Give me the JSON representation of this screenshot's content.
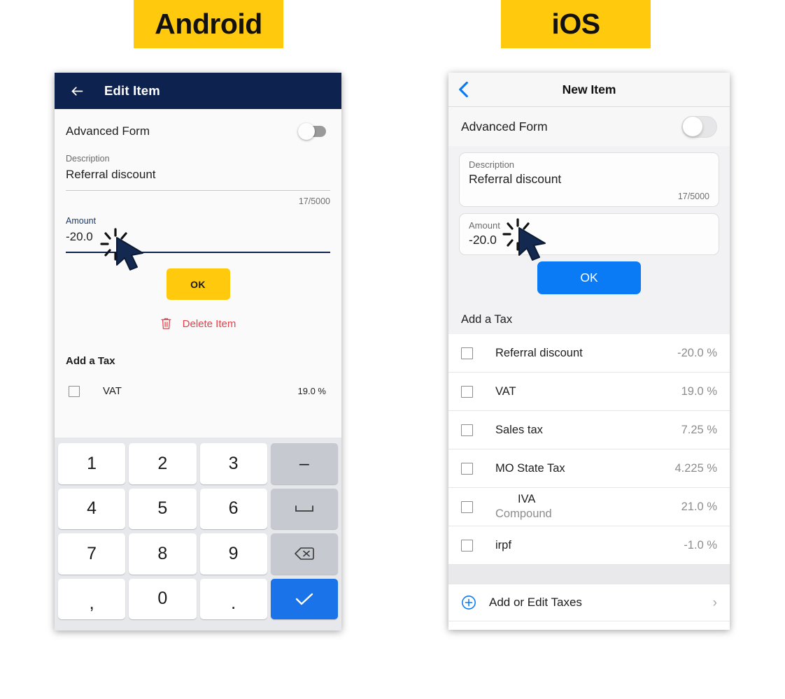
{
  "badges": {
    "android": "Android",
    "ios": "iOS"
  },
  "colors": {
    "brand_yellow": "#FFC90E",
    "android_toolbar": "#0E2250",
    "ios_blue": "#0A7BF5",
    "delete_red": "#E8414A"
  },
  "android": {
    "toolbar": {
      "back_icon": "arrow-left-icon",
      "title": "Edit Item"
    },
    "advanced_form": {
      "label": "Advanced Form",
      "toggle_state": "off"
    },
    "description_field": {
      "label": "Description",
      "value": "Referral discount",
      "counter": "17/5000"
    },
    "amount_field": {
      "label": "Amount",
      "value": "-20.0",
      "focused": true
    },
    "ok_button": "OK",
    "delete_item": {
      "icon": "trash-icon",
      "label": "Delete Item"
    },
    "add_a_tax_title": "Add a Tax",
    "taxes": [
      {
        "name": "VAT",
        "rate": "19.0 %",
        "checked": false
      }
    ],
    "keyboard": {
      "keys": [
        {
          "label": "1",
          "kind": "num",
          "name": "key-1"
        },
        {
          "label": "2",
          "kind": "num",
          "name": "key-2"
        },
        {
          "label": "3",
          "kind": "num",
          "name": "key-3"
        },
        {
          "label": "–",
          "kind": "grey",
          "name": "key-minus"
        },
        {
          "label": "4",
          "kind": "num",
          "name": "key-4"
        },
        {
          "label": "5",
          "kind": "num",
          "name": "key-5"
        },
        {
          "label": "6",
          "kind": "num",
          "name": "key-6"
        },
        {
          "label": "",
          "kind": "grey-space",
          "name": "key-space"
        },
        {
          "label": "7",
          "kind": "num",
          "name": "key-7"
        },
        {
          "label": "8",
          "kind": "num",
          "name": "key-8"
        },
        {
          "label": "9",
          "kind": "num",
          "name": "key-9"
        },
        {
          "label": "",
          "kind": "grey-backspace",
          "name": "key-backspace"
        },
        {
          "label": ",",
          "kind": "num",
          "name": "key-comma"
        },
        {
          "label": "0",
          "kind": "num",
          "name": "key-0"
        },
        {
          "label": ".",
          "kind": "num",
          "name": "key-period"
        },
        {
          "label": "",
          "kind": "blue-check",
          "name": "key-done"
        }
      ]
    }
  },
  "ios": {
    "nav": {
      "back_icon": "chevron-left-icon",
      "title": "New Item"
    },
    "advanced_form": {
      "label": "Advanced Form",
      "toggle_state": "off"
    },
    "description_field": {
      "label": "Description",
      "value": "Referral discount",
      "counter": "17/5000"
    },
    "amount_field": {
      "label": "Amount",
      "value": "-20.0"
    },
    "ok_button": "OK",
    "add_a_tax_title": "Add a Tax",
    "taxes": [
      {
        "name": "Referral discount",
        "sub": "",
        "rate": "-20.0 %",
        "checked": false
      },
      {
        "name": "VAT",
        "sub": "",
        "rate": "19.0 %",
        "checked": false
      },
      {
        "name": "Sales tax",
        "sub": "",
        "rate": "7.25 %",
        "checked": false
      },
      {
        "name": "MO State Tax",
        "sub": "",
        "rate": "4.225 %",
        "checked": false
      },
      {
        "name": "IVA",
        "sub": "Compound",
        "rate": "21.0 %",
        "checked": false
      },
      {
        "name": "irpf",
        "sub": "",
        "rate": "-1.0 %",
        "checked": false
      }
    ],
    "add_or_edit": {
      "icon": "plus-circle-icon",
      "label": "Add or Edit Taxes",
      "chevron": "›"
    }
  }
}
